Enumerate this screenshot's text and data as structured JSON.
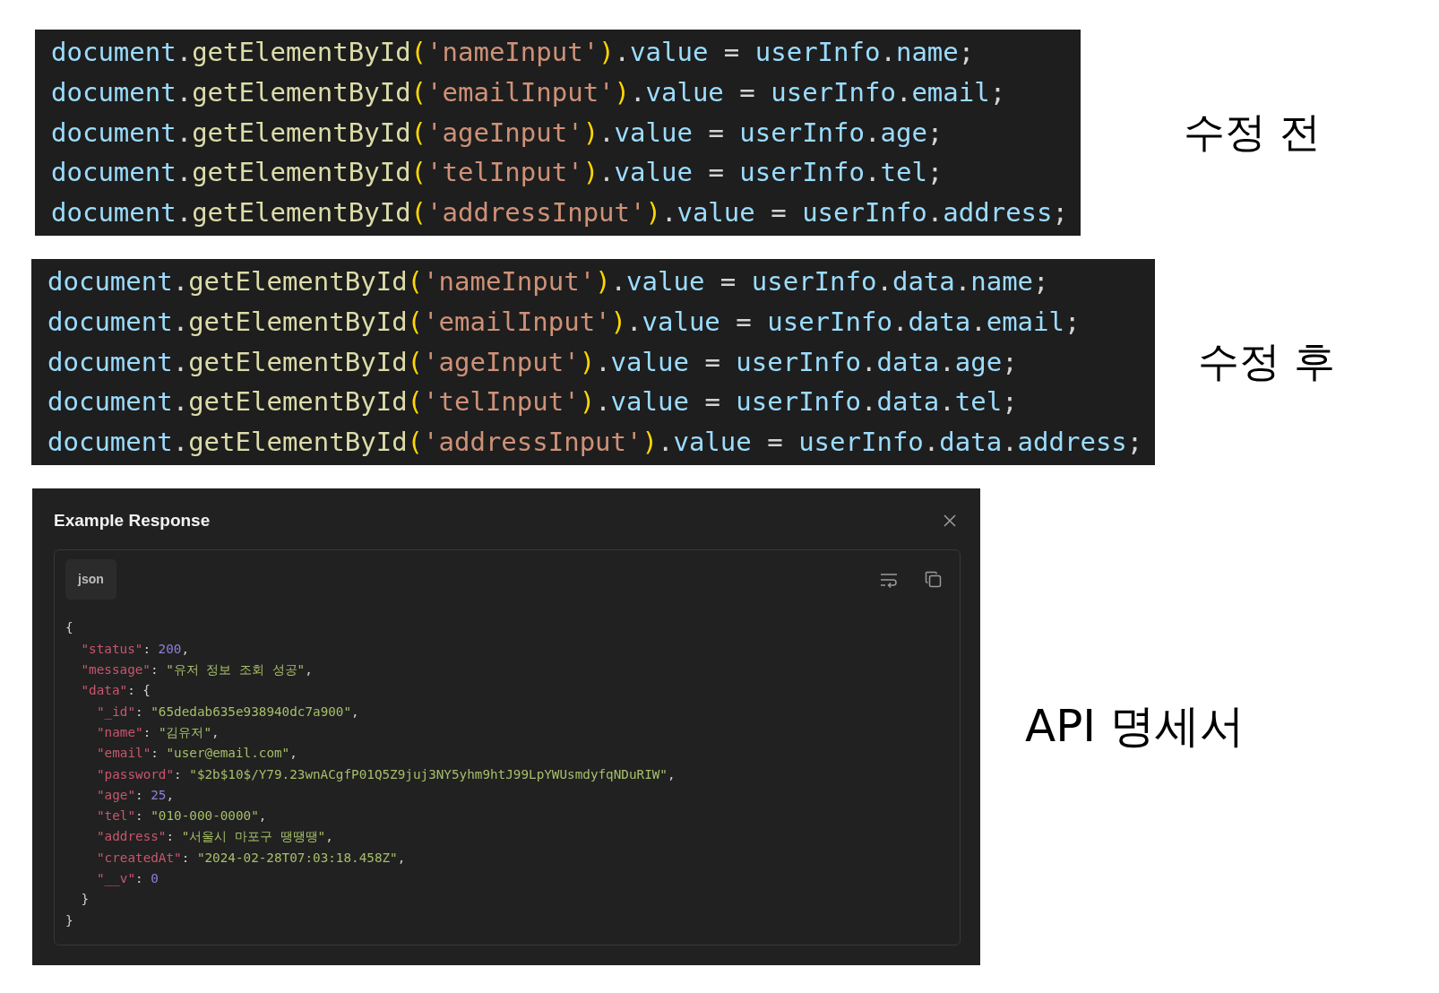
{
  "code_snippets": [
    {
      "caption": "수정 전",
      "lines": [
        [
          {
            "text": "document",
            "kind": "variable"
          },
          {
            "text": ".",
            "kind": "punct"
          },
          {
            "text": "getElementById",
            "kind": "function"
          },
          {
            "text": "(",
            "kind": "bracket"
          },
          {
            "text": "'nameInput'",
            "kind": "string"
          },
          {
            "text": ")",
            "kind": "bracket"
          },
          {
            "text": ".",
            "kind": "punct"
          },
          {
            "text": "value",
            "kind": "variable"
          },
          {
            "text": " = ",
            "kind": "punct"
          },
          {
            "text": "userInfo",
            "kind": "variable"
          },
          {
            "text": ".",
            "kind": "punct"
          },
          {
            "text": "name",
            "kind": "variable"
          },
          {
            "text": ";",
            "kind": "punct"
          }
        ],
        [
          {
            "text": "document",
            "kind": "variable"
          },
          {
            "text": ".",
            "kind": "punct"
          },
          {
            "text": "getElementById",
            "kind": "function"
          },
          {
            "text": "(",
            "kind": "bracket"
          },
          {
            "text": "'emailInput'",
            "kind": "string"
          },
          {
            "text": ")",
            "kind": "bracket"
          },
          {
            "text": ".",
            "kind": "punct"
          },
          {
            "text": "value",
            "kind": "variable"
          },
          {
            "text": " = ",
            "kind": "punct"
          },
          {
            "text": "userInfo",
            "kind": "variable"
          },
          {
            "text": ".",
            "kind": "punct"
          },
          {
            "text": "email",
            "kind": "variable"
          },
          {
            "text": ";",
            "kind": "punct"
          }
        ],
        [
          {
            "text": "document",
            "kind": "variable"
          },
          {
            "text": ".",
            "kind": "punct"
          },
          {
            "text": "getElementById",
            "kind": "function"
          },
          {
            "text": "(",
            "kind": "bracket"
          },
          {
            "text": "'ageInput'",
            "kind": "string"
          },
          {
            "text": ")",
            "kind": "bracket"
          },
          {
            "text": ".",
            "kind": "punct"
          },
          {
            "text": "value",
            "kind": "variable"
          },
          {
            "text": " = ",
            "kind": "punct"
          },
          {
            "text": "userInfo",
            "kind": "variable"
          },
          {
            "text": ".",
            "kind": "punct"
          },
          {
            "text": "age",
            "kind": "variable"
          },
          {
            "text": ";",
            "kind": "punct"
          }
        ],
        [
          {
            "text": "document",
            "kind": "variable"
          },
          {
            "text": ".",
            "kind": "punct"
          },
          {
            "text": "getElementById",
            "kind": "function"
          },
          {
            "text": "(",
            "kind": "bracket"
          },
          {
            "text": "'telInput'",
            "kind": "string"
          },
          {
            "text": ")",
            "kind": "bracket"
          },
          {
            "text": ".",
            "kind": "punct"
          },
          {
            "text": "value",
            "kind": "variable"
          },
          {
            "text": " = ",
            "kind": "punct"
          },
          {
            "text": "userInfo",
            "kind": "variable"
          },
          {
            "text": ".",
            "kind": "punct"
          },
          {
            "text": "tel",
            "kind": "variable"
          },
          {
            "text": ";",
            "kind": "punct"
          }
        ],
        [
          {
            "text": "document",
            "kind": "variable"
          },
          {
            "text": ".",
            "kind": "punct"
          },
          {
            "text": "getElementById",
            "kind": "function"
          },
          {
            "text": "(",
            "kind": "bracket"
          },
          {
            "text": "'addressInput'",
            "kind": "string"
          },
          {
            "text": ")",
            "kind": "bracket"
          },
          {
            "text": ".",
            "kind": "punct"
          },
          {
            "text": "value",
            "kind": "variable"
          },
          {
            "text": " = ",
            "kind": "punct"
          },
          {
            "text": "userInfo",
            "kind": "variable"
          },
          {
            "text": ".",
            "kind": "punct"
          },
          {
            "text": "address",
            "kind": "variable"
          },
          {
            "text": ";",
            "kind": "punct"
          }
        ]
      ]
    },
    {
      "caption": "수정 후",
      "lines": [
        [
          {
            "text": "document",
            "kind": "variable"
          },
          {
            "text": ".",
            "kind": "punct"
          },
          {
            "text": "getElementById",
            "kind": "function"
          },
          {
            "text": "(",
            "kind": "bracket"
          },
          {
            "text": "'nameInput'",
            "kind": "string"
          },
          {
            "text": ")",
            "kind": "bracket"
          },
          {
            "text": ".",
            "kind": "punct"
          },
          {
            "text": "value",
            "kind": "variable"
          },
          {
            "text": " = ",
            "kind": "punct"
          },
          {
            "text": "userInfo",
            "kind": "variable"
          },
          {
            "text": ".",
            "kind": "punct"
          },
          {
            "text": "data",
            "kind": "variable"
          },
          {
            "text": ".",
            "kind": "punct"
          },
          {
            "text": "name",
            "kind": "variable"
          },
          {
            "text": ";",
            "kind": "punct"
          }
        ],
        [
          {
            "text": "document",
            "kind": "variable"
          },
          {
            "text": ".",
            "kind": "punct"
          },
          {
            "text": "getElementById",
            "kind": "function"
          },
          {
            "text": "(",
            "kind": "bracket"
          },
          {
            "text": "'emailInput'",
            "kind": "string"
          },
          {
            "text": ")",
            "kind": "bracket"
          },
          {
            "text": ".",
            "kind": "punct"
          },
          {
            "text": "value",
            "kind": "variable"
          },
          {
            "text": " = ",
            "kind": "punct"
          },
          {
            "text": "userInfo",
            "kind": "variable"
          },
          {
            "text": ".",
            "kind": "punct"
          },
          {
            "text": "data",
            "kind": "variable"
          },
          {
            "text": ".",
            "kind": "punct"
          },
          {
            "text": "email",
            "kind": "variable"
          },
          {
            "text": ";",
            "kind": "punct"
          }
        ],
        [
          {
            "text": "document",
            "kind": "variable"
          },
          {
            "text": ".",
            "kind": "punct"
          },
          {
            "text": "getElementById",
            "kind": "function"
          },
          {
            "text": "(",
            "kind": "bracket"
          },
          {
            "text": "'ageInput'",
            "kind": "string"
          },
          {
            "text": ")",
            "kind": "bracket"
          },
          {
            "text": ".",
            "kind": "punct"
          },
          {
            "text": "value",
            "kind": "variable"
          },
          {
            "text": " = ",
            "kind": "punct"
          },
          {
            "text": "userInfo",
            "kind": "variable"
          },
          {
            "text": ".",
            "kind": "punct"
          },
          {
            "text": "data",
            "kind": "variable"
          },
          {
            "text": ".",
            "kind": "punct"
          },
          {
            "text": "age",
            "kind": "variable"
          },
          {
            "text": ";",
            "kind": "punct"
          }
        ],
        [
          {
            "text": "document",
            "kind": "variable"
          },
          {
            "text": ".",
            "kind": "punct"
          },
          {
            "text": "getElementById",
            "kind": "function"
          },
          {
            "text": "(",
            "kind": "bracket"
          },
          {
            "text": "'telInput'",
            "kind": "string"
          },
          {
            "text": ")",
            "kind": "bracket"
          },
          {
            "text": ".",
            "kind": "punct"
          },
          {
            "text": "value",
            "kind": "variable"
          },
          {
            "text": " = ",
            "kind": "punct"
          },
          {
            "text": "userInfo",
            "kind": "variable"
          },
          {
            "text": ".",
            "kind": "punct"
          },
          {
            "text": "data",
            "kind": "variable"
          },
          {
            "text": ".",
            "kind": "punct"
          },
          {
            "text": "tel",
            "kind": "variable"
          },
          {
            "text": ";",
            "kind": "punct"
          }
        ],
        [
          {
            "text": "document",
            "kind": "variable"
          },
          {
            "text": ".",
            "kind": "punct"
          },
          {
            "text": "getElementById",
            "kind": "function"
          },
          {
            "text": "(",
            "kind": "bracket"
          },
          {
            "text": "'addressInput'",
            "kind": "string"
          },
          {
            "text": ")",
            "kind": "bracket"
          },
          {
            "text": ".",
            "kind": "punct"
          },
          {
            "text": "value",
            "kind": "variable"
          },
          {
            "text": " = ",
            "kind": "punct"
          },
          {
            "text": "userInfo",
            "kind": "variable"
          },
          {
            "text": ".",
            "kind": "punct"
          },
          {
            "text": "data",
            "kind": "variable"
          },
          {
            "text": ".",
            "kind": "punct"
          },
          {
            "text": "address",
            "kind": "variable"
          },
          {
            "text": ";",
            "kind": "punct"
          }
        ]
      ]
    }
  ],
  "response_panel": {
    "caption": "API 명세서",
    "title": "Example Response",
    "language": "json",
    "lines": [
      {
        "tokens": [
          {
            "text": "{",
            "kind": "punct"
          }
        ],
        "close": [
          {
            "text": "}",
            "kind": "punct"
          }
        ],
        "children": [
          {
            "tokens": [
              {
                "text": "\"status\"",
                "kind": "key"
              },
              {
                "text": ": ",
                "kind": "punct"
              },
              {
                "text": "200",
                "kind": "number"
              },
              {
                "text": ",",
                "kind": "punct"
              }
            ]
          },
          {
            "tokens": [
              {
                "text": "\"message\"",
                "kind": "key"
              },
              {
                "text": ": ",
                "kind": "punct"
              },
              {
                "text": "\"유저 정보 조회 성공\"",
                "kind": "string"
              },
              {
                "text": ",",
                "kind": "punct"
              }
            ]
          },
          {
            "tokens": [
              {
                "text": "\"data\"",
                "kind": "key"
              },
              {
                "text": ": {",
                "kind": "punct"
              }
            ],
            "close": [
              {
                "text": "}",
                "kind": "punct"
              }
            ],
            "children": [
              {
                "tokens": [
                  {
                    "text": "\"_id\"",
                    "kind": "key"
                  },
                  {
                    "text": ": ",
                    "kind": "punct"
                  },
                  {
                    "text": "\"65dedab635e938940dc7a900\"",
                    "kind": "string"
                  },
                  {
                    "text": ",",
                    "kind": "punct"
                  }
                ]
              },
              {
                "tokens": [
                  {
                    "text": "\"name\"",
                    "kind": "key"
                  },
                  {
                    "text": ": ",
                    "kind": "punct"
                  },
                  {
                    "text": "\"김유저\"",
                    "kind": "string"
                  },
                  {
                    "text": ",",
                    "kind": "punct"
                  }
                ]
              },
              {
                "tokens": [
                  {
                    "text": "\"email\"",
                    "kind": "key"
                  },
                  {
                    "text": ": ",
                    "kind": "punct"
                  },
                  {
                    "text": "\"user@email.com\"",
                    "kind": "string"
                  },
                  {
                    "text": ",",
                    "kind": "punct"
                  }
                ]
              },
              {
                "tokens": [
                  {
                    "text": "\"password\"",
                    "kind": "key"
                  },
                  {
                    "text": ": ",
                    "kind": "punct"
                  },
                  {
                    "text": "\"$2b$10$/Y79.23wnACgfP01Q5Z9juj3NY5yhm9htJ99LpYWUsmdyfqNDuRIW\"",
                    "kind": "string"
                  },
                  {
                    "text": ",",
                    "kind": "punct"
                  }
                ]
              },
              {
                "tokens": [
                  {
                    "text": "\"age\"",
                    "kind": "key"
                  },
                  {
                    "text": ": ",
                    "kind": "punct"
                  },
                  {
                    "text": "25",
                    "kind": "number"
                  },
                  {
                    "text": ",",
                    "kind": "punct"
                  }
                ]
              },
              {
                "tokens": [
                  {
                    "text": "\"tel\"",
                    "kind": "key"
                  },
                  {
                    "text": ": ",
                    "kind": "punct"
                  },
                  {
                    "text": "\"010-000-0000\"",
                    "kind": "string"
                  },
                  {
                    "text": ",",
                    "kind": "punct"
                  }
                ]
              },
              {
                "tokens": [
                  {
                    "text": "\"address\"",
                    "kind": "key"
                  },
                  {
                    "text": ": ",
                    "kind": "punct"
                  },
                  {
                    "text": "\"서울시 마포구 땡땡땡\"",
                    "kind": "string"
                  },
                  {
                    "text": ",",
                    "kind": "punct"
                  }
                ]
              },
              {
                "tokens": [
                  {
                    "text": "\"createdAt\"",
                    "kind": "key"
                  },
                  {
                    "text": ": ",
                    "kind": "punct"
                  },
                  {
                    "text": "\"2024-02-28T07:03:18.458Z\"",
                    "kind": "string"
                  },
                  {
                    "text": ",",
                    "kind": "punct"
                  }
                ]
              },
              {
                "tokens": [
                  {
                    "text": "\"__v\"",
                    "kind": "key"
                  },
                  {
                    "text": ": ",
                    "kind": "punct"
                  },
                  {
                    "text": "0",
                    "kind": "number"
                  }
                ]
              }
            ]
          }
        ]
      }
    ]
  }
}
